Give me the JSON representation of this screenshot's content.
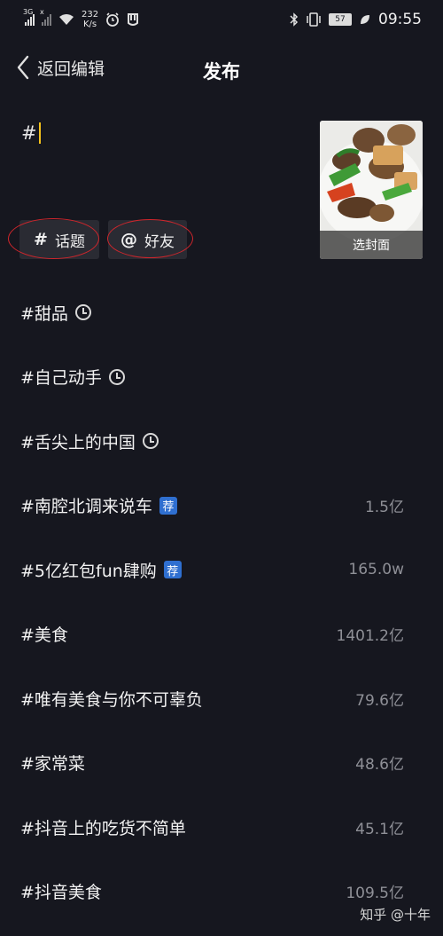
{
  "status_bar": {
    "network": "3G",
    "signal2_mark": "x",
    "net_speed_value": "232",
    "net_speed_unit": "K/s",
    "battery": "57",
    "time": "09:55"
  },
  "nav": {
    "back_label": "返回编辑",
    "title": "发布"
  },
  "editor": {
    "text": "#"
  },
  "cover": {
    "label": "选封面"
  },
  "chips": {
    "topic_icon": "#",
    "topic_label": "话题",
    "friend_icon": "@",
    "friend_label": "好友"
  },
  "topics": [
    {
      "text": "#甜品",
      "icon": "clock-icon",
      "count": ""
    },
    {
      "text": "#自己动手",
      "icon": "clock-icon",
      "count": ""
    },
    {
      "text": "#舌尖上的中国",
      "icon": "clock-icon",
      "count": ""
    },
    {
      "text": "#南腔北调来说车",
      "icon": "recommend-badge",
      "badge": "荐",
      "count": "1.5亿"
    },
    {
      "text": "#5亿红包fun肆购",
      "icon": "recommend-badge",
      "badge": "荐",
      "count": "165.0w"
    },
    {
      "text": "#美食",
      "icon": "",
      "count": "1401.2亿"
    },
    {
      "text": "#唯有美食与你不可辜负",
      "icon": "",
      "count": "79.6亿"
    },
    {
      "text": "#家常菜",
      "icon": "",
      "count": "48.6亿"
    },
    {
      "text": "#抖音上的吃货不简单",
      "icon": "",
      "count": "45.1亿"
    },
    {
      "text": "#抖音美食",
      "icon": "",
      "count": "109.5亿"
    }
  ],
  "watermark": {
    "text": "知乎 @十年"
  },
  "colors": {
    "background": "#16171f",
    "caret": "#f4c21b",
    "annotation_circle": "#d0262c",
    "recommend_badge": "#2f6fd0"
  }
}
